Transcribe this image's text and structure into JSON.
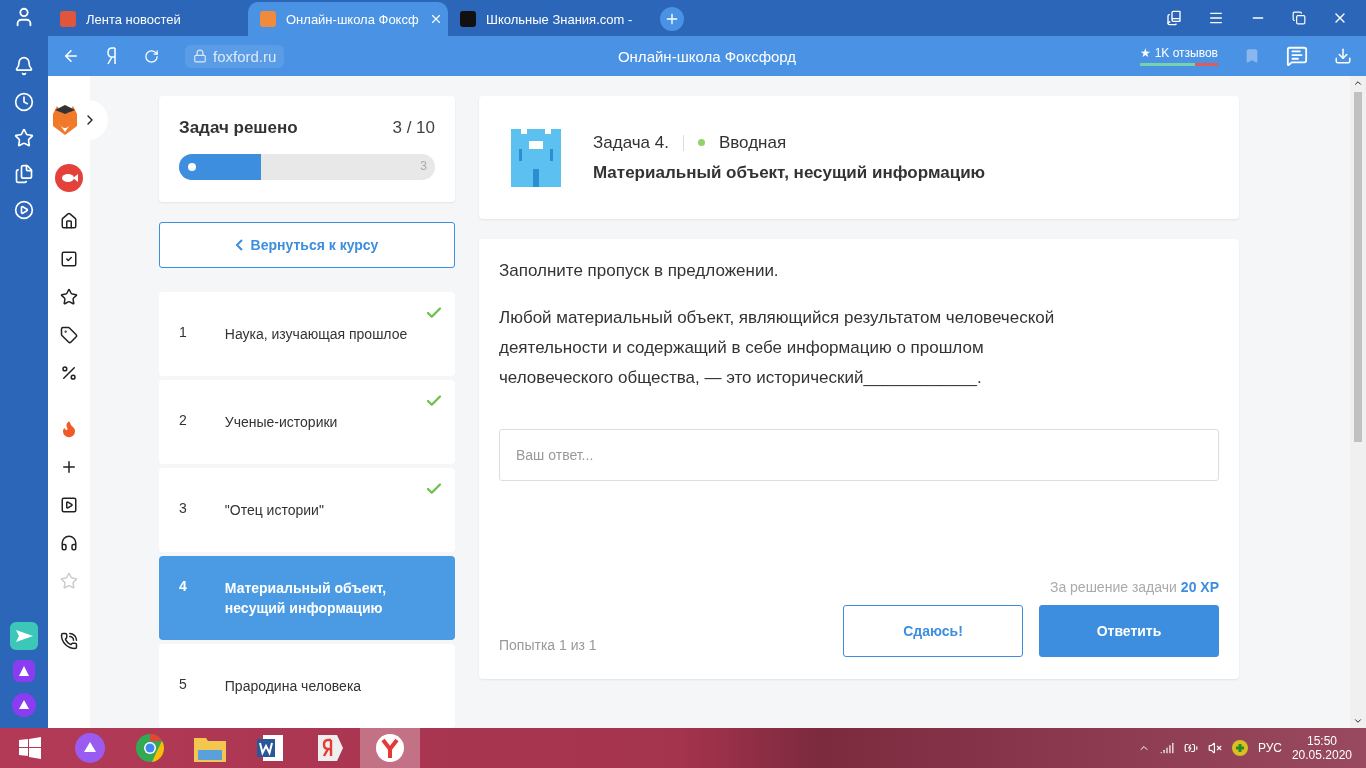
{
  "browser": {
    "tabs": [
      {
        "title": "Лента новостей",
        "selected": false
      },
      {
        "title": "Онлайн-школа Фоксф",
        "selected": true
      },
      {
        "title": "Школьные Знания.com -",
        "selected": false
      }
    ],
    "address": "foxford.ru",
    "page_title": "Онлайн-школа Фоксфорд",
    "reviews": "★ 1K отзывов"
  },
  "progress": {
    "title": "Задач решено",
    "count": "3 / 10",
    "level": 0.32,
    "end_label": "3"
  },
  "back_button": "Вернуться к курсу",
  "tasks": [
    {
      "number": "1",
      "title": "Наука, изучающая прошлое",
      "done": true,
      "selected": false
    },
    {
      "number": "2",
      "title": "Ученые-историки",
      "done": true,
      "selected": false
    },
    {
      "number": "3",
      "title": "\"Отец истории\"",
      "done": true,
      "selected": false
    },
    {
      "number": "4",
      "title": "Материальный объект, несущий информацию",
      "done": false,
      "selected": true
    },
    {
      "number": "5",
      "title": "Прародина человека",
      "done": false,
      "selected": false
    }
  ],
  "task": {
    "label": "Задача 4.",
    "level_name": "Вводная",
    "title": "Материальный объект, несущий информацию",
    "instruction": "Заполните пропуск в предложении.",
    "question": "Любой материальный объект, являющийся результатом человеческой деятельности и содержащий в себе информацию о прошлом человеческого общества, — это исторический____________.",
    "answer_placeholder": "Ваш ответ...",
    "reward_label": "За решение задачи",
    "reward_xp": "20 XP",
    "attempt": "Попытка 1 из 1",
    "buttons": [
      "Сдаюсь!",
      "Ответить"
    ]
  },
  "taskbar": {
    "language": "РУС",
    "time": "15:50",
    "date": "20.05.2020"
  }
}
